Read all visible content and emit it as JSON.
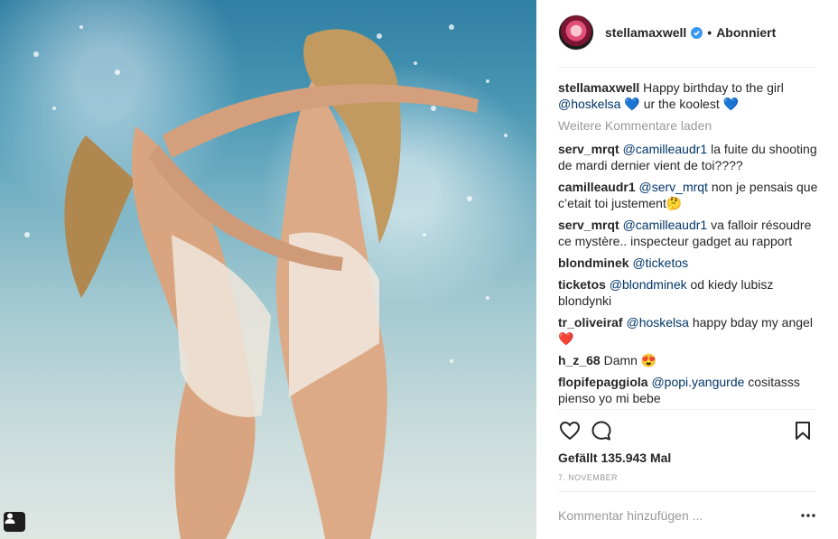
{
  "post": {
    "username": "stellamaxwell",
    "follow_status": "Abonniert",
    "dot": "•",
    "caption_user": "stellamaxwell",
    "caption_text_1": "Happy birthday to the girl",
    "caption_mention": "@hoskelsa",
    "caption_emoji_1": "💙",
    "caption_text_2": "ur the koolest",
    "caption_emoji_2": "💙",
    "load_more": "Weitere Kommentare laden",
    "likes": "Gefällt 135.943 Mal",
    "date": "7. NOVEMBER",
    "comment_placeholder": "Kommentar hinzufügen ..."
  },
  "comments": [
    {
      "user": "serv_mrqt",
      "mention": "@camilleaudr1",
      "text": "la fuite du shooting de mardi dernier vient de toi????"
    },
    {
      "user": "camilleaudr1",
      "mention": "@serv_mrqt",
      "text": "non je pensais que c’etait toi justement",
      "emoji": "🤔"
    },
    {
      "user": "serv_mrqt",
      "mention": "@camilleaudr1",
      "text": "va falloir résoudre ce mystère.. inspecteur gadget au rapport"
    },
    {
      "user": "blondminek",
      "mention": "@ticketos",
      "text": ""
    },
    {
      "user": "ticketos",
      "mention": "@blondminek",
      "text": "od kiedy lubisz blondynki"
    },
    {
      "user": "tr_oliveiraf",
      "mention": "@hoskelsa",
      "text": "happy bday my angel",
      "emoji": "❤️"
    },
    {
      "user": "h_z_68",
      "mention": "",
      "text": "Damn",
      "emoji": "😍"
    },
    {
      "user": "flopifepaggiola",
      "mention": "@popi.yangurde",
      "text": "cositasss pienso yo mi bebe"
    }
  ],
  "icons": {
    "like": "heart-icon",
    "comment": "comment-icon",
    "save": "bookmark-icon",
    "more": "more-options-icon",
    "verified": "verified-badge-icon",
    "tag": "user-tag-icon"
  },
  "colors": {
    "username": "#262626",
    "mention": "#003569",
    "muted": "#999999",
    "verified": "#3897f0",
    "divider": "#efefef"
  }
}
